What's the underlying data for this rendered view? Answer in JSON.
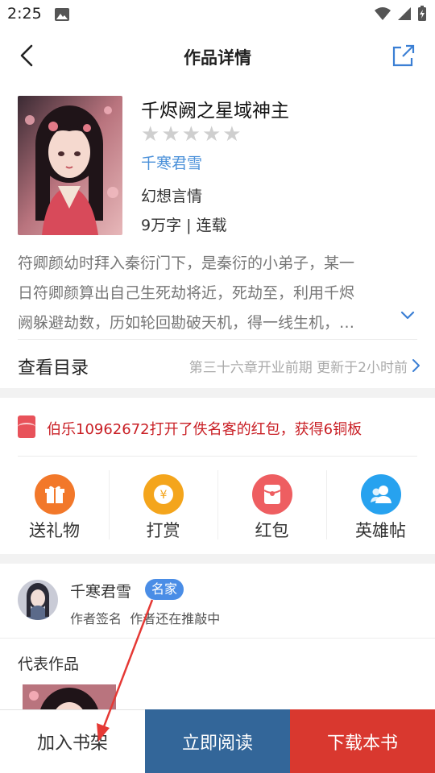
{
  "status_bar": {
    "time": "2:25"
  },
  "header": {
    "title": "作品详情"
  },
  "book": {
    "title": "千烬阙之星域神主",
    "author": "千寒君雪",
    "genre": "幻想言情",
    "words_status": "9万字 | 连载",
    "rating": 0,
    "rating_max": 5,
    "synopsis_lines": [
      "符卿颜幼时拜入秦衍门下，是秦衍的小弟子，某一",
      "日符卿颜算出自己生死劫将近，死劫至，利用千烬",
      "阙躲避劫数，历如轮回勘破天机，得一线生机，…"
    ]
  },
  "catalog": {
    "label": "查看目录",
    "latest": "第三十六章开业前期  更新于2小时前"
  },
  "notice": {
    "text": "伯乐10962672打开了佚名客的红包，获得6铜板"
  },
  "actions": [
    {
      "label": "送礼物",
      "icon": "gift-icon",
      "color": "#f2782a"
    },
    {
      "label": "打赏",
      "icon": "yuan-coin-icon",
      "color": "#f4a51c"
    },
    {
      "label": "红包",
      "icon": "red-packet-icon",
      "color": "#ee5e61"
    },
    {
      "label": "英雄帖",
      "icon": "users-icon",
      "color": "#27a2ef"
    }
  ],
  "author_card": {
    "name": "千寒君雪",
    "badge": "名家",
    "signature_label": "作者签名",
    "signature": "作者还在推敲中"
  },
  "representative": {
    "label": "代表作品"
  },
  "bottom_bar": {
    "add_shelf": "加入书架",
    "read_now": "立即阅读",
    "download": "下载本书"
  },
  "colors": {
    "accent_blue": "#4a90d9",
    "read_button": "#336699",
    "download_button": "#d9382f",
    "notice_red": "#c91f25",
    "annotation_arrow": "#e53935"
  }
}
